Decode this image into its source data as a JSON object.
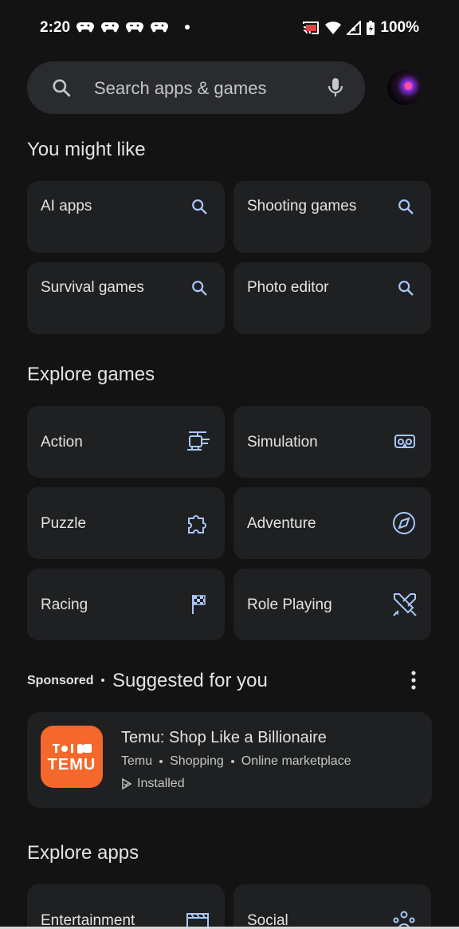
{
  "status_bar": {
    "time": "2:20",
    "battery": "100%",
    "notification_icons": [
      "game-controller-icon",
      "game-controller-icon",
      "game-controller-icon",
      "game-controller-icon"
    ],
    "system_icons": [
      "cast-icon",
      "wifi-icon",
      "signal-icon",
      "battery-icon"
    ]
  },
  "search": {
    "placeholder": "Search apps & games",
    "icon": "search-icon",
    "mic_icon": "mic-icon"
  },
  "you_might_like": {
    "title": "You might like",
    "items": [
      {
        "label": "AI apps",
        "icon": "search-icon"
      },
      {
        "label": "Shooting games",
        "icon": "search-icon"
      },
      {
        "label": "Survival games",
        "icon": "search-icon"
      },
      {
        "label": "Photo editor",
        "icon": "search-icon"
      }
    ]
  },
  "explore_games": {
    "title": "Explore games",
    "items": [
      {
        "label": "Action",
        "icon": "helicopter-icon"
      },
      {
        "label": "Simulation",
        "icon": "vr-headset-icon"
      },
      {
        "label": "Puzzle",
        "icon": "puzzle-icon"
      },
      {
        "label": "Adventure",
        "icon": "compass-icon"
      },
      {
        "label": "Racing",
        "icon": "checkered-flag-icon"
      },
      {
        "label": "Role Playing",
        "icon": "crossed-swords-icon"
      }
    ]
  },
  "suggested": {
    "sponsored_label": "Sponsored",
    "title": "Suggested for you",
    "app": {
      "name": "Temu: Shop Like a Billionaire",
      "logo_text": "TEMU",
      "developer": "Temu",
      "category": "Shopping",
      "tag": "Online marketplace",
      "status": "Installed"
    }
  },
  "explore_apps": {
    "title": "Explore apps",
    "items": [
      {
        "label": "Entertainment",
        "icon": "clapperboard-icon"
      },
      {
        "label": "Social",
        "icon": "people-icon"
      }
    ]
  },
  "colors": {
    "background": "#131314",
    "card": "#1f2022",
    "search_bar": "#2a2b2e",
    "icon_accent": "#a8c7fa",
    "temu_orange": "#f4682c"
  }
}
